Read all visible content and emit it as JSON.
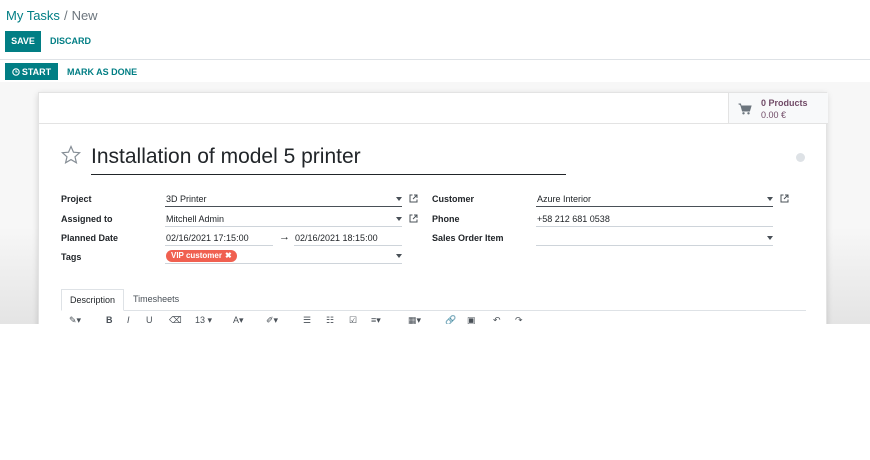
{
  "breadcrumb": {
    "parent": "My Tasks",
    "separator": "/",
    "current": "New"
  },
  "toolbar": {
    "save_label": "SAVE",
    "discard_label": "DISCARD"
  },
  "statusbar": {
    "start_label": "START",
    "mark_done_label": "MARK AS DONE"
  },
  "smart_button": {
    "count_label": "0 Products",
    "amount": "0.00 €"
  },
  "task": {
    "title": "Installation of model 5 printer",
    "priority_icon": "star-icon",
    "kanban_state_color": "#dee2e6"
  },
  "fields": {
    "project_label": "Project",
    "project_value": "3D Printer",
    "assigned_label": "Assigned to",
    "assigned_value": "Mitchell Admin",
    "planned_label": "Planned Date",
    "planned_start": "02/16/2021 17:15:00",
    "planned_arrow": "→",
    "planned_end": "02/16/2021 18:15:00",
    "tags_label": "Tags",
    "tag_value": "VIP customer",
    "tag_color": "#f06050",
    "customer_label": "Customer",
    "customer_value": "Azure Interior",
    "phone_label": "Phone",
    "phone_value": "+58 212 681 0538",
    "so_item_label": "Sales Order Item",
    "so_item_value": ""
  },
  "tabs": [
    {
      "label": "Description",
      "active": true
    },
    {
      "label": "Timesheets",
      "active": false
    }
  ],
  "editor": {
    "font_size": "13"
  },
  "colors": {
    "accent": "#017e84",
    "brand_purple": "#714b67"
  }
}
